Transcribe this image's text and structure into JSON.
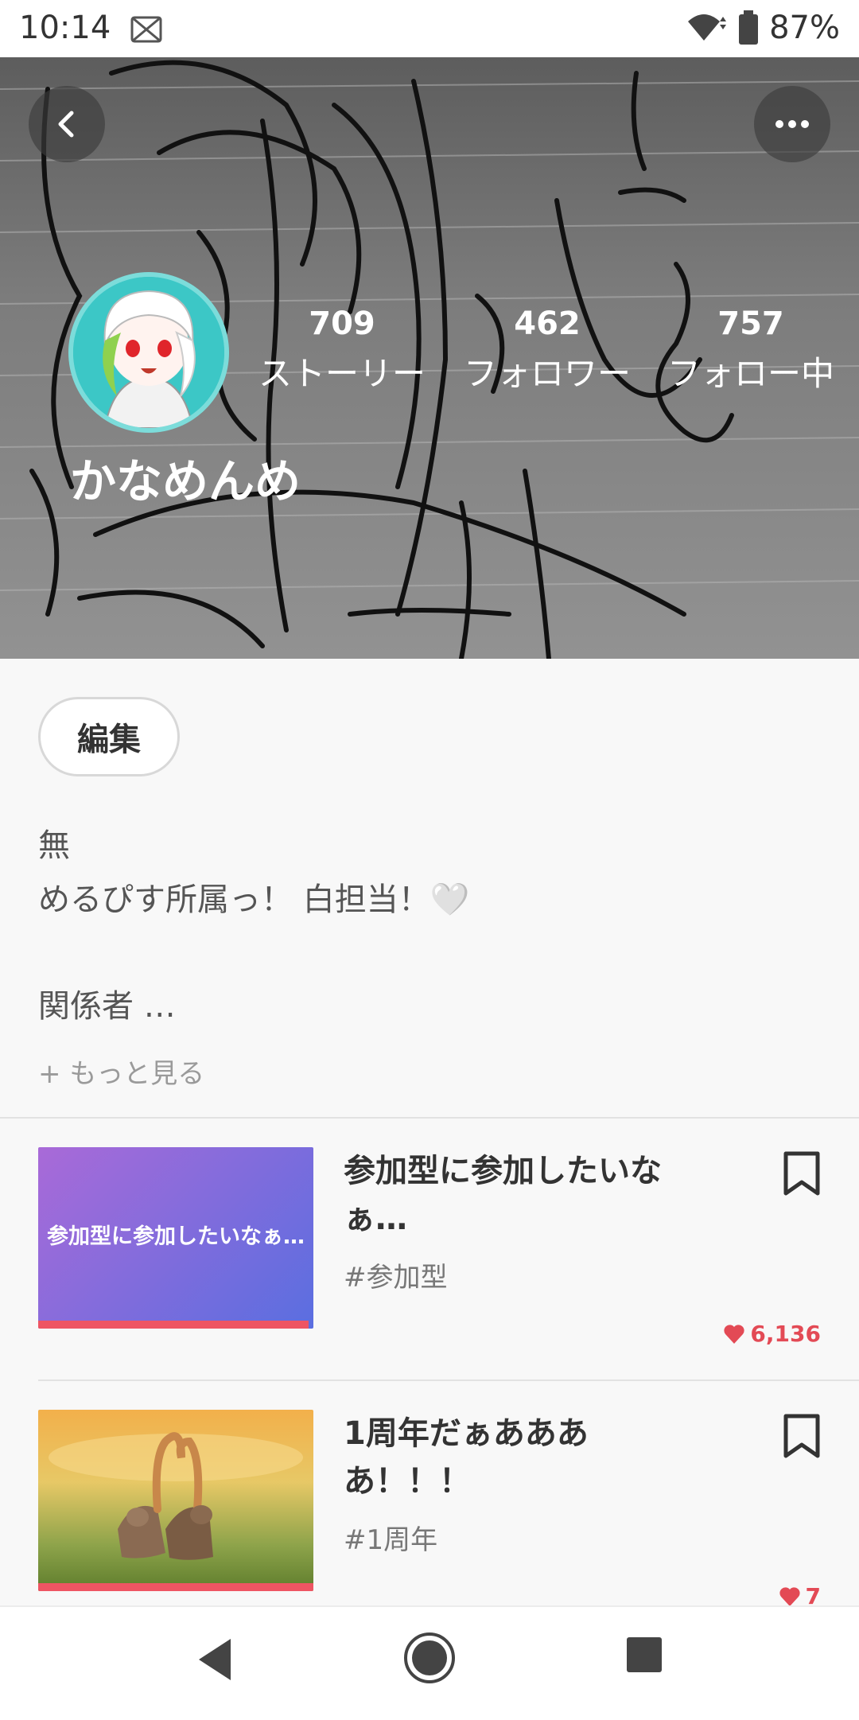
{
  "status_bar": {
    "time": "10:14",
    "battery": "87%",
    "icons": [
      "notification-icon",
      "wifi-icon",
      "battery-icon"
    ]
  },
  "header": {
    "back_icon": "chevron-left-icon",
    "more_icon": "more-horizontal-icon",
    "stats": [
      {
        "value": "709",
        "label": "ストーリー"
      },
      {
        "value": "462",
        "label": "フォロワー"
      },
      {
        "value": "757",
        "label": "フォロー中"
      }
    ],
    "username": "かなめんめ"
  },
  "profile": {
    "edit_label": "編集",
    "bio": [
      "無",
      "めるぴす所属っ！ 白担当！🤍",
      "関係者 …"
    ],
    "see_more": "+ もっと見る"
  },
  "stories": [
    {
      "thumb_title": "参加型に参加したいなぁ…",
      "title": "参加型に参加したいなぁ…",
      "tag": "#参加型",
      "likes": "6,136"
    },
    {
      "thumb_title": "",
      "title": "1周年だぁああああ！！！",
      "tag": "#1周年",
      "likes": "7"
    }
  ],
  "colors": {
    "accent_red": "#ee5563",
    "like_red": "#e34a55",
    "thumb_gradient_start": "#a96ad8",
    "thumb_gradient_end": "#5a6ee0"
  },
  "nav_bar": {
    "icons": [
      "back-triangle-icon",
      "home-circle-icon",
      "recents-square-icon"
    ]
  }
}
